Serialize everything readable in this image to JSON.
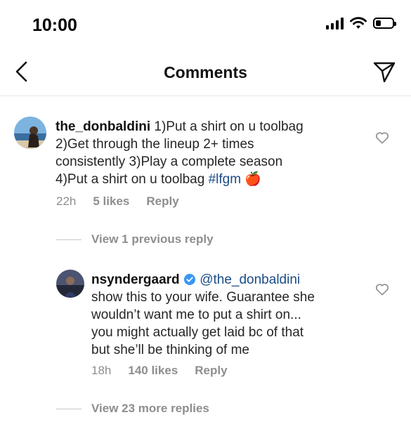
{
  "status": {
    "time": "10:00"
  },
  "nav": {
    "title": "Comments"
  },
  "comments": [
    {
      "username": "the_donbaldini",
      "text_lines": [
        "1)Put a shirt on u toolbag",
        "2)Get through the lineup 2+ times",
        "consistently  3)Play a complete  season",
        "4)Put a shirt on u toolbag "
      ],
      "hashtag": "#lfgm",
      "emoji": "🍎",
      "time": "22h",
      "likes": "5 likes",
      "reply": "Reply"
    },
    {
      "username": "nsyndergaard",
      "mention": "@the_donbaldini",
      "text_lines": [
        "show this to your wife. Guarantee she",
        "wouldn’t want me to put a shirt on...",
        "you might actually get laid bc of that",
        "but she’ll be thinking of me"
      ],
      "time": "18h",
      "likes": "140 likes",
      "reply": "Reply"
    }
  ],
  "view_previous": "View 1 previous reply",
  "view_more": "View 23 more replies",
  "colors": {
    "link": "#1b4c86",
    "meta": "#8e8e8e",
    "verified": "#3897f0"
  }
}
